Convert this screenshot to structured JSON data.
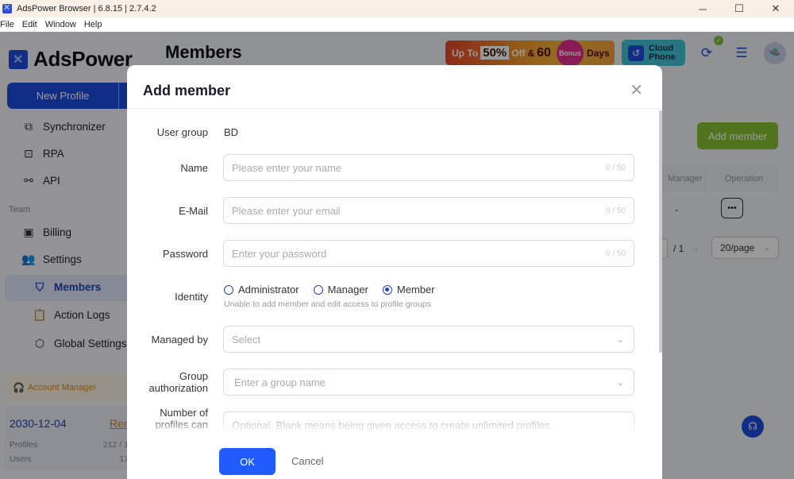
{
  "window": {
    "title": "AdsPower Browser | 6.8.15 | 2.7.4.2",
    "controls": {
      "minimize": "─",
      "maximize": "☐",
      "close": "✕"
    }
  },
  "menubar": [
    "File",
    "Edit",
    "Window",
    "Help"
  ],
  "sidebar": {
    "logo_text": "AdsPower",
    "new_profile_label": "New Profile",
    "items": [
      {
        "label": "Synchronizer",
        "icon": "synchronizer-icon"
      },
      {
        "label": "RPA",
        "icon": "robot-icon"
      },
      {
        "label": "API",
        "icon": "api-plug-icon"
      }
    ],
    "team_section": "Team",
    "team_items": [
      {
        "label": "Billing",
        "icon": "billing-icon"
      },
      {
        "label": "Settings",
        "icon": "users-icon"
      }
    ],
    "settings_sub": [
      {
        "label": "Members",
        "icon": "shield-icon",
        "active": true
      },
      {
        "label": "Action Logs",
        "icon": "clipboard-icon"
      },
      {
        "label": "Global Settings",
        "icon": "hexagon-gear-icon"
      }
    ],
    "account_manager": "Account Manager",
    "plan": {
      "expiry": "2030-12-04",
      "renew": "Ren",
      "profiles_label": "Profiles",
      "profiles_value": "212 / 1",
      "users_label": "Users",
      "users_value": "17"
    }
  },
  "header": {
    "title": "Members",
    "promo": {
      "up_to": "Up To",
      "percent": "50%",
      "off": "Off",
      "amp": "&",
      "days_num": "60",
      "bonus": "Bonus",
      "days": "Days"
    },
    "cloud_phone": {
      "line1": "Cloud",
      "line2": "Phone"
    }
  },
  "members_page": {
    "add_member_label": "Add member",
    "columns": [
      "Manager",
      "Operation"
    ],
    "row": {
      "manager": "-",
      "operation": "•••"
    },
    "pagination": {
      "total": "/ 1",
      "next": "›",
      "page_size": "20/page"
    }
  },
  "modal": {
    "title": "Add member",
    "fields": {
      "user_group": {
        "label": "User group",
        "value": "BD"
      },
      "name": {
        "label": "Name",
        "placeholder": "Please enter your name",
        "count": "0 / 50"
      },
      "email": {
        "label": "E-Mail",
        "placeholder": "Please enter your email",
        "count": "0 / 50"
      },
      "password": {
        "label": "Password",
        "placeholder": "Enter your password",
        "count": "0 / 50"
      },
      "identity": {
        "label": "Identity",
        "options": [
          "Administrator",
          "Manager",
          "Member"
        ],
        "selected": "Member",
        "hint": "Unable to add member and edit access to profile groups"
      },
      "managed_by": {
        "label": "Managed by",
        "placeholder": "Select"
      },
      "group_authorization": {
        "label_line1": "Group",
        "label_line2": "authorization",
        "placeholder": "Enter a group name"
      },
      "profile_limit": {
        "label_line1": "Number of",
        "label_line2": "profiles can",
        "placeholder": "Optional. Blank means being given access to create unlimited profiles."
      }
    },
    "ok_label": "OK",
    "cancel_label": "Cancel"
  }
}
